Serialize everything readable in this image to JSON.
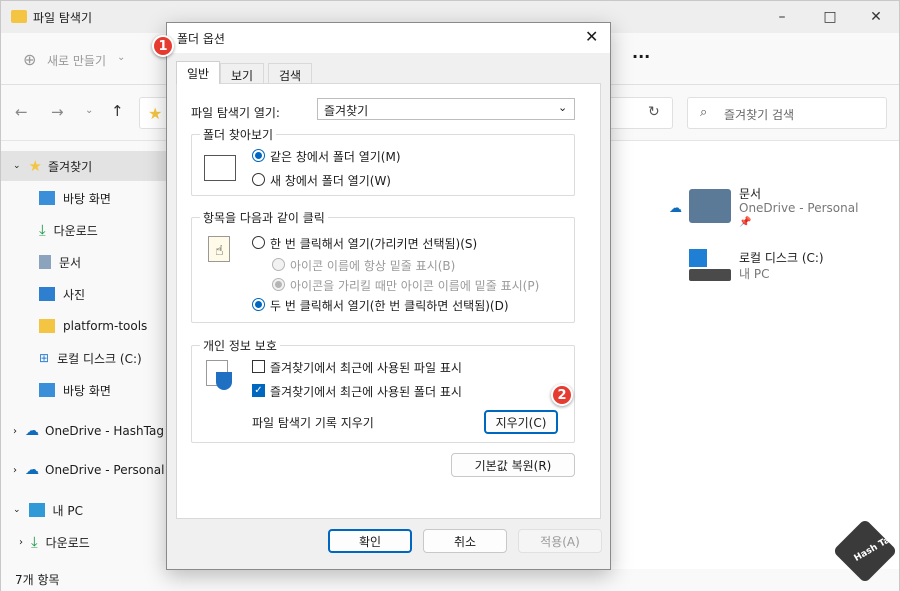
{
  "explorer": {
    "title": "파일 탐색기",
    "new_button": "새로 만들기",
    "more": "···",
    "search_placeholder": "즐겨찾기 검색",
    "nav": [
      {
        "label": "즐겨찾기"
      },
      {
        "label": "바탕 화면"
      },
      {
        "label": "다운로드"
      },
      {
        "label": "문서"
      },
      {
        "label": "사진"
      },
      {
        "label": "platform-tools"
      },
      {
        "label": "로컬 디스크 (C:)"
      },
      {
        "label": "바탕 화면"
      },
      {
        "label": "OneDrive - HashTag"
      },
      {
        "label": "OneDrive - Personal"
      },
      {
        "label": "내 PC"
      },
      {
        "label": "다운로드"
      }
    ],
    "items": [
      {
        "name": "문서",
        "sub": "OneDrive - Personal"
      },
      {
        "name": "로컬 디스크 (C:)",
        "sub": "내 PC"
      }
    ],
    "status": "7개 항목"
  },
  "dialog": {
    "title": "폴더 옵션",
    "tabs": [
      "일반",
      "보기",
      "검색"
    ],
    "open_explorer_label": "파일 탐색기 열기:",
    "open_explorer_value": "즐겨찾기",
    "browse_group": "폴더 찾아보기",
    "browse_same": "같은 창에서 폴더 열기(M)",
    "browse_new": "새 창에서 폴더 열기(W)",
    "click_group": "항목을 다음과 같이 클릭",
    "single_click": "한 번 클릭해서 열기(가리키면 선택됨)(S)",
    "underline_always": "아이콘 이름에 항상 밑줄 표시(B)",
    "underline_hover": "아이콘을 가리킬 때만 아이콘 이름에 밑줄 표시(P)",
    "double_click": "두 번 클릭해서 열기(한 번 클릭하면 선택됨)(D)",
    "privacy_group": "개인 정보 보호",
    "recent_files": "즐겨찾기에서 최근에 사용된 파일 표시",
    "recent_folders": "즐겨찾기에서 최근에 사용된 폴더 표시",
    "clear_history_label": "파일 탐색기 기록 지우기",
    "clear_button": "지우기(C)",
    "restore_button": "기본값 복원(R)",
    "ok": "확인",
    "cancel": "취소",
    "apply": "적용(A)"
  },
  "markers": [
    "1",
    "2"
  ],
  "watermark": "Hash Tag",
  "colors": {
    "accent": "#0067c0",
    "marker": "#e53b30",
    "folder": "#f4c542"
  }
}
